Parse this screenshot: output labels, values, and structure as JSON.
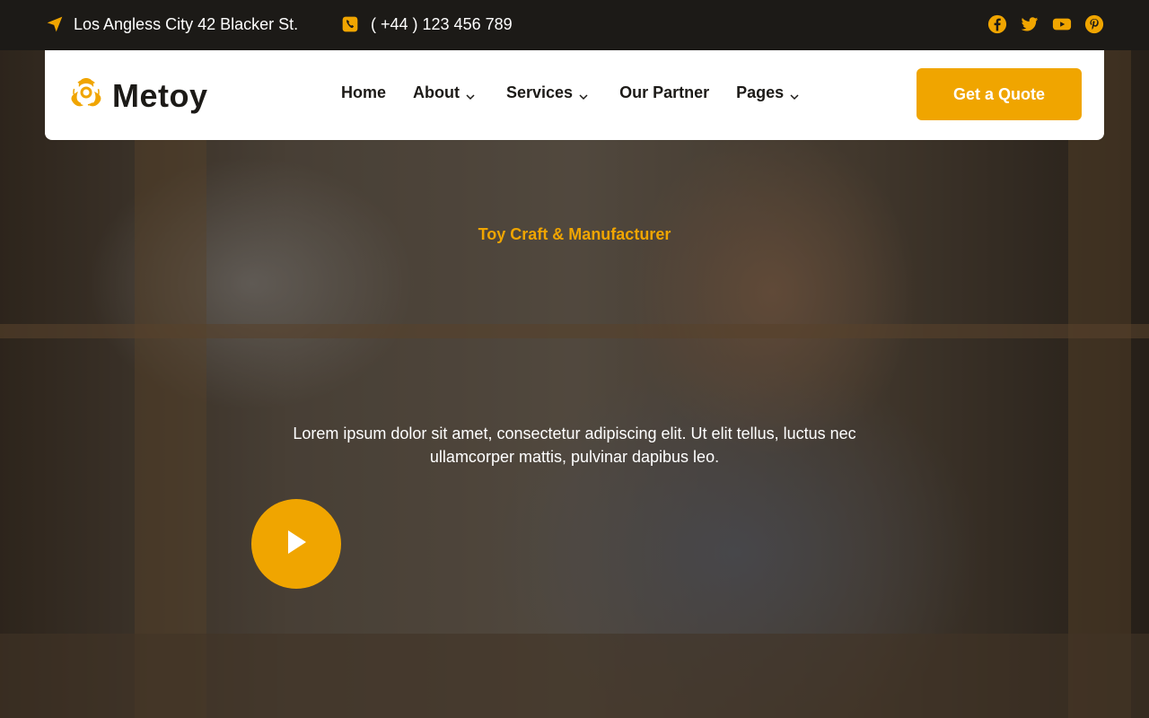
{
  "topbar": {
    "address": "Los Angless City 42 Blacker St.",
    "phone": "( +44 ) 123 456 789",
    "social": [
      "facebook-icon",
      "twitter-icon",
      "youtube-icon",
      "pinterest-icon"
    ]
  },
  "brand": {
    "name": "Metoy",
    "accent": "#f0a500",
    "dark": "#1c1a17"
  },
  "nav": {
    "items": [
      {
        "label": "Home",
        "dropdown": false
      },
      {
        "label": "About",
        "dropdown": true
      },
      {
        "label": "Services",
        "dropdown": true
      },
      {
        "label": "Our Partner",
        "dropdown": false
      },
      {
        "label": "Pages",
        "dropdown": true
      }
    ],
    "cta": "Get a Quote"
  },
  "hero": {
    "eyebrow": "Toy Craft & Manufacturer",
    "description": "Lorem ipsum dolor sit amet, consectetur adipiscing elit. Ut elit tellus, luctus nec ullamcorper mattis, pulvinar dapibus leo.",
    "play_icon": "play-icon"
  }
}
